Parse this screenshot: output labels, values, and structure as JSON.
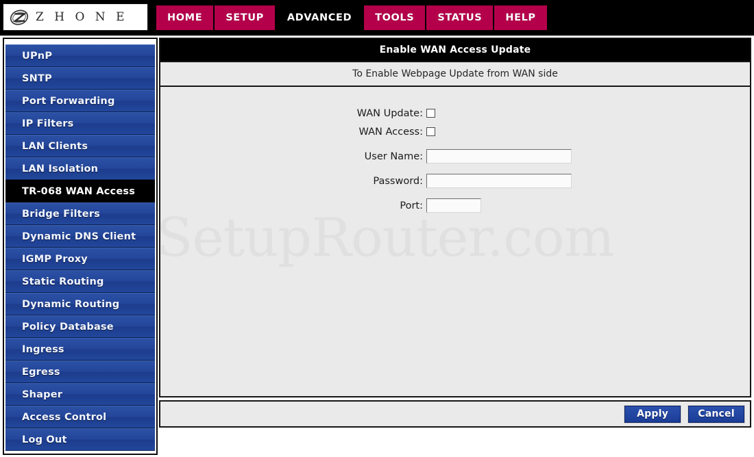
{
  "brand": {
    "name": "Z H O N E",
    "logo_icon": "zhone-z-emblem-icon"
  },
  "nav": {
    "items": [
      {
        "label": "HOME",
        "active": false
      },
      {
        "label": "SETUP",
        "active": false
      },
      {
        "label": "ADVANCED",
        "active": true
      },
      {
        "label": "TOOLS",
        "active": false
      },
      {
        "label": "STATUS",
        "active": false
      },
      {
        "label": "HELP",
        "active": false
      }
    ],
    "accent_color": "#b4004a",
    "active_color": "#000000"
  },
  "sidebar": {
    "items": [
      {
        "label": "UPnP",
        "active": false
      },
      {
        "label": "SNTP",
        "active": false
      },
      {
        "label": "Port Forwarding",
        "active": false
      },
      {
        "label": "IP Filters",
        "active": false
      },
      {
        "label": "LAN Clients",
        "active": false
      },
      {
        "label": "LAN Isolation",
        "active": false
      },
      {
        "label": "TR-068 WAN Access",
        "active": true
      },
      {
        "label": "Bridge Filters",
        "active": false
      },
      {
        "label": "Dynamic DNS Client",
        "active": false
      },
      {
        "label": "IGMP Proxy",
        "active": false
      },
      {
        "label": "Static Routing",
        "active": false
      },
      {
        "label": "Dynamic Routing",
        "active": false
      },
      {
        "label": "Policy Database",
        "active": false
      },
      {
        "label": "Ingress",
        "active": false
      },
      {
        "label": "Egress",
        "active": false
      },
      {
        "label": "Shaper",
        "active": false
      },
      {
        "label": "Access Control",
        "active": false
      },
      {
        "label": "Log Out",
        "active": false
      }
    ],
    "item_color": "#24469a",
    "active_color": "#000000"
  },
  "panel": {
    "title": "Enable WAN Access Update",
    "subtitle": "To Enable Webpage Update from WAN side"
  },
  "watermark": {
    "text": "SetupRouter.com"
  },
  "form": {
    "fields": [
      {
        "label": "WAN Update:",
        "type": "checkbox",
        "checked": false,
        "name": "wan-update"
      },
      {
        "label": "WAN Access:",
        "type": "checkbox",
        "checked": false,
        "name": "wan-access"
      },
      {
        "label": "User Name:",
        "type": "text",
        "value": "",
        "placeholder": "",
        "name": "user-name",
        "width": "wide"
      },
      {
        "label": "Password:",
        "type": "password",
        "value": "",
        "placeholder": "",
        "name": "password",
        "width": "wide"
      },
      {
        "label": "Port:",
        "type": "text",
        "value": "",
        "placeholder": "",
        "name": "port",
        "width": "narrow"
      }
    ]
  },
  "footer": {
    "apply_label": "Apply",
    "cancel_label": "Cancel",
    "button_color": "#1c3f9e"
  }
}
